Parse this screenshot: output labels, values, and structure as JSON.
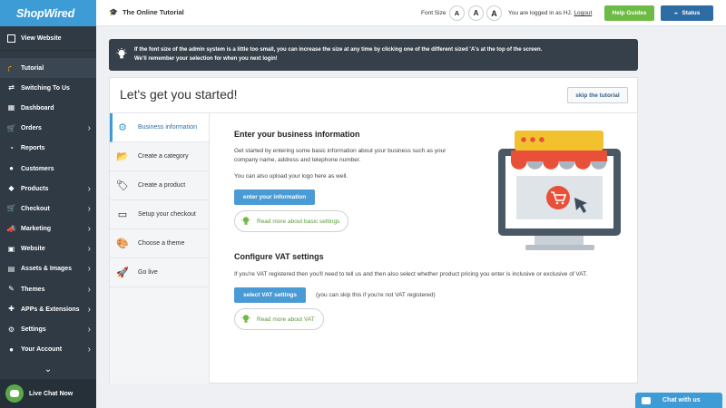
{
  "brand": {
    "logo": "ShopWired"
  },
  "sidebar": {
    "view_website": "View Website",
    "items": [
      {
        "label": "Tutorial",
        "icon": "graduation-cap-icon",
        "glyph": "🎓",
        "chevron": false
      },
      {
        "label": "Switching To Us",
        "icon": "switch-icon",
        "glyph": "⇄",
        "chevron": false
      },
      {
        "label": "Dashboard",
        "icon": "dashboard-icon",
        "glyph": "▦",
        "chevron": false
      },
      {
        "label": "Orders",
        "icon": "orders-icon",
        "glyph": "🛒",
        "chevron": true
      },
      {
        "label": "Reports",
        "icon": "reports-icon",
        "glyph": "◔",
        "chevron": false
      },
      {
        "label": "Customers",
        "icon": "customers-icon",
        "glyph": "●",
        "chevron": false
      },
      {
        "label": "Products",
        "icon": "products-icon",
        "glyph": "◆",
        "chevron": true
      },
      {
        "label": "Checkout",
        "icon": "checkout-icon",
        "glyph": "🛒",
        "chevron": true
      },
      {
        "label": "Marketing",
        "icon": "megaphone-icon",
        "glyph": "📣",
        "chevron": true
      },
      {
        "label": "Website",
        "icon": "website-icon",
        "glyph": "▣",
        "chevron": true
      },
      {
        "label": "Assets & Images",
        "icon": "images-icon",
        "glyph": "▤",
        "chevron": true
      },
      {
        "label": "Themes",
        "icon": "themes-icon",
        "glyph": "✎",
        "chevron": true
      },
      {
        "label": "APPs & Extensions",
        "icon": "apps-icon",
        "glyph": "✚",
        "chevron": true
      },
      {
        "label": "Settings",
        "icon": "gear-icon",
        "glyph": "⚙",
        "chevron": true
      },
      {
        "label": "Your Account",
        "icon": "user-icon",
        "glyph": "●",
        "chevron": true
      }
    ],
    "live_chat": "Live Chat Now"
  },
  "topbar": {
    "title": "The Online Tutorial",
    "font_size_label": "Font Size",
    "font_buttons": [
      "A",
      "A",
      "A"
    ],
    "logged_in_text": "You are logged in as HJ.",
    "logout": "Logout",
    "help_guides": "Help Guides",
    "status": "Status"
  },
  "notice": {
    "line1": "If the font size of the admin system is a little too small, you can increase the size at any time by clicking one of the different sized 'A's at the top of the screen.",
    "line2": "We'll remember your selection for when you next login!"
  },
  "card": {
    "title": "Let's get you started!",
    "skip": "skip the tutorial",
    "steps": [
      {
        "label": "Business information",
        "icon": "gear-icon",
        "glyph": "⚙",
        "active": true
      },
      {
        "label": "Create a category",
        "icon": "folder-icon",
        "glyph": "📂",
        "active": false
      },
      {
        "label": "Create a product",
        "icon": "tag-icon",
        "glyph": "🏷",
        "active": false
      },
      {
        "label": "Setup your checkout",
        "icon": "credit-card-icon",
        "glyph": "▭",
        "active": false
      },
      {
        "label": "Choose a theme",
        "icon": "palette-icon",
        "glyph": "🎨",
        "active": false
      },
      {
        "label": "Go live",
        "icon": "rocket-icon",
        "glyph": "🚀",
        "active": false
      }
    ],
    "business": {
      "title": "Enter your business information",
      "para1": "Get started by entering some basic information about your business such as your company name, address and telephone number.",
      "para2": "You can also upload your logo here as well.",
      "button": "enter your information",
      "read_more": "Read more about basic settings"
    },
    "vat": {
      "title": "Configure VAT settings",
      "para": "If you're VAT registered then you'll need to tell us and then also select whether product pricing you enter is inclusive or exclusive of VAT.",
      "button": "select VAT settings",
      "hint": "(you can skip this if you're not VAT registered)",
      "read_more": "Read more about VAT"
    }
  },
  "chat": {
    "label": "Chat with us"
  },
  "colors": {
    "brand_blue": "#3d9bd6",
    "sidebar": "#2f3a45",
    "help_green": "#6dbb45",
    "status_blue": "#2e6da4"
  }
}
